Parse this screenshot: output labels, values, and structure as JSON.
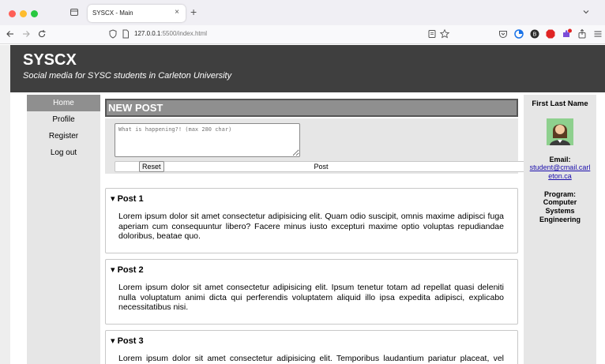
{
  "browser": {
    "tab_title": "SYSCX - Main",
    "tab_close": "×",
    "new_tab": "+",
    "url_host": "127.0.0.1",
    "url_rest": ":5500/index.html"
  },
  "site": {
    "title": "SYSCX",
    "subtitle": "Social media for SYSC students in Carleton University"
  },
  "nav": {
    "items": [
      {
        "label": "Home"
      },
      {
        "label": "Profile"
      },
      {
        "label": "Register"
      },
      {
        "label": "Log out"
      }
    ]
  },
  "new_post": {
    "heading": "NEW POST",
    "placeholder": "What is happening?! (max 280 char)",
    "post_label": "Post",
    "reset_label": "Reset"
  },
  "posts": [
    {
      "title": "▾ Post 1",
      "body": "Lorem ipsum dolor sit amet consectetur adipisicing elit. Quam odio suscipit, omnis maxime adipisci fuga aperiam cum consequuntur libero? Facere minus iusto excepturi maxime optio voluptas repudiandae doloribus, beatae quo."
    },
    {
      "title": "▾ Post 2",
      "body": "Lorem ipsum dolor sit amet consectetur adipisicing elit. Ipsum tenetur totam ad repellat quasi deleniti nulla voluptatum animi dicta qui perferendis voluptatem aliquid illo ipsa expedita adipisci, explicabo necessitatibus nisi."
    },
    {
      "title": "▾ Post 3",
      "body": "Lorem ipsum dolor sit amet consectetur adipisicing elit. Temporibus laudantium pariatur placeat, vel labore reiciendis ullam dolorem laboriosam porro, explicabo culpa facere distinctio"
    }
  ],
  "profile": {
    "name": "First Last Name",
    "email_label": "Email:",
    "email": "student@cmail.carleton.ca",
    "program_label": "Program:",
    "program": "Computer Systems Engineering"
  },
  "colors": {
    "header_bg": "#3f3f3f",
    "accent_gray": "#8f8f8f",
    "panel_bg": "#e6e6e6",
    "link": "#1a0dab"
  }
}
